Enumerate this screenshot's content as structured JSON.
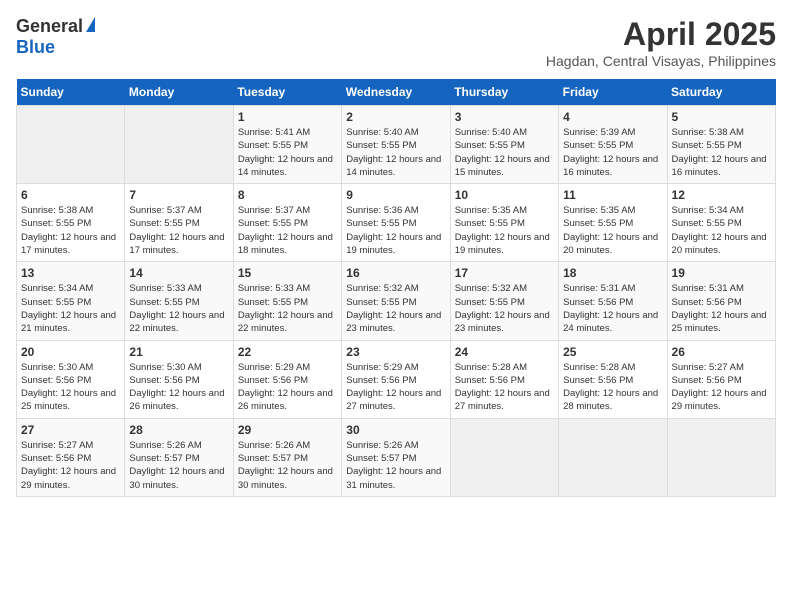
{
  "header": {
    "logo_general": "General",
    "logo_blue": "Blue",
    "title": "April 2025",
    "subtitle": "Hagdan, Central Visayas, Philippines"
  },
  "columns": [
    "Sunday",
    "Monday",
    "Tuesday",
    "Wednesday",
    "Thursday",
    "Friday",
    "Saturday"
  ],
  "weeks": [
    [
      {
        "day": "",
        "info": ""
      },
      {
        "day": "",
        "info": ""
      },
      {
        "day": "1",
        "info": "Sunrise: 5:41 AM\nSunset: 5:55 PM\nDaylight: 12 hours and 14 minutes."
      },
      {
        "day": "2",
        "info": "Sunrise: 5:40 AM\nSunset: 5:55 PM\nDaylight: 12 hours and 14 minutes."
      },
      {
        "day": "3",
        "info": "Sunrise: 5:40 AM\nSunset: 5:55 PM\nDaylight: 12 hours and 15 minutes."
      },
      {
        "day": "4",
        "info": "Sunrise: 5:39 AM\nSunset: 5:55 PM\nDaylight: 12 hours and 16 minutes."
      },
      {
        "day": "5",
        "info": "Sunrise: 5:38 AM\nSunset: 5:55 PM\nDaylight: 12 hours and 16 minutes."
      }
    ],
    [
      {
        "day": "6",
        "info": "Sunrise: 5:38 AM\nSunset: 5:55 PM\nDaylight: 12 hours and 17 minutes."
      },
      {
        "day": "7",
        "info": "Sunrise: 5:37 AM\nSunset: 5:55 PM\nDaylight: 12 hours and 17 minutes."
      },
      {
        "day": "8",
        "info": "Sunrise: 5:37 AM\nSunset: 5:55 PM\nDaylight: 12 hours and 18 minutes."
      },
      {
        "day": "9",
        "info": "Sunrise: 5:36 AM\nSunset: 5:55 PM\nDaylight: 12 hours and 19 minutes."
      },
      {
        "day": "10",
        "info": "Sunrise: 5:35 AM\nSunset: 5:55 PM\nDaylight: 12 hours and 19 minutes."
      },
      {
        "day": "11",
        "info": "Sunrise: 5:35 AM\nSunset: 5:55 PM\nDaylight: 12 hours and 20 minutes."
      },
      {
        "day": "12",
        "info": "Sunrise: 5:34 AM\nSunset: 5:55 PM\nDaylight: 12 hours and 20 minutes."
      }
    ],
    [
      {
        "day": "13",
        "info": "Sunrise: 5:34 AM\nSunset: 5:55 PM\nDaylight: 12 hours and 21 minutes."
      },
      {
        "day": "14",
        "info": "Sunrise: 5:33 AM\nSunset: 5:55 PM\nDaylight: 12 hours and 22 minutes."
      },
      {
        "day": "15",
        "info": "Sunrise: 5:33 AM\nSunset: 5:55 PM\nDaylight: 12 hours and 22 minutes."
      },
      {
        "day": "16",
        "info": "Sunrise: 5:32 AM\nSunset: 5:55 PM\nDaylight: 12 hours and 23 minutes."
      },
      {
        "day": "17",
        "info": "Sunrise: 5:32 AM\nSunset: 5:55 PM\nDaylight: 12 hours and 23 minutes."
      },
      {
        "day": "18",
        "info": "Sunrise: 5:31 AM\nSunset: 5:56 PM\nDaylight: 12 hours and 24 minutes."
      },
      {
        "day": "19",
        "info": "Sunrise: 5:31 AM\nSunset: 5:56 PM\nDaylight: 12 hours and 25 minutes."
      }
    ],
    [
      {
        "day": "20",
        "info": "Sunrise: 5:30 AM\nSunset: 5:56 PM\nDaylight: 12 hours and 25 minutes."
      },
      {
        "day": "21",
        "info": "Sunrise: 5:30 AM\nSunset: 5:56 PM\nDaylight: 12 hours and 26 minutes."
      },
      {
        "day": "22",
        "info": "Sunrise: 5:29 AM\nSunset: 5:56 PM\nDaylight: 12 hours and 26 minutes."
      },
      {
        "day": "23",
        "info": "Sunrise: 5:29 AM\nSunset: 5:56 PM\nDaylight: 12 hours and 27 minutes."
      },
      {
        "day": "24",
        "info": "Sunrise: 5:28 AM\nSunset: 5:56 PM\nDaylight: 12 hours and 27 minutes."
      },
      {
        "day": "25",
        "info": "Sunrise: 5:28 AM\nSunset: 5:56 PM\nDaylight: 12 hours and 28 minutes."
      },
      {
        "day": "26",
        "info": "Sunrise: 5:27 AM\nSunset: 5:56 PM\nDaylight: 12 hours and 29 minutes."
      }
    ],
    [
      {
        "day": "27",
        "info": "Sunrise: 5:27 AM\nSunset: 5:56 PM\nDaylight: 12 hours and 29 minutes."
      },
      {
        "day": "28",
        "info": "Sunrise: 5:26 AM\nSunset: 5:57 PM\nDaylight: 12 hours and 30 minutes."
      },
      {
        "day": "29",
        "info": "Sunrise: 5:26 AM\nSunset: 5:57 PM\nDaylight: 12 hours and 30 minutes."
      },
      {
        "day": "30",
        "info": "Sunrise: 5:26 AM\nSunset: 5:57 PM\nDaylight: 12 hours and 31 minutes."
      },
      {
        "day": "",
        "info": ""
      },
      {
        "day": "",
        "info": ""
      },
      {
        "day": "",
        "info": ""
      }
    ]
  ]
}
